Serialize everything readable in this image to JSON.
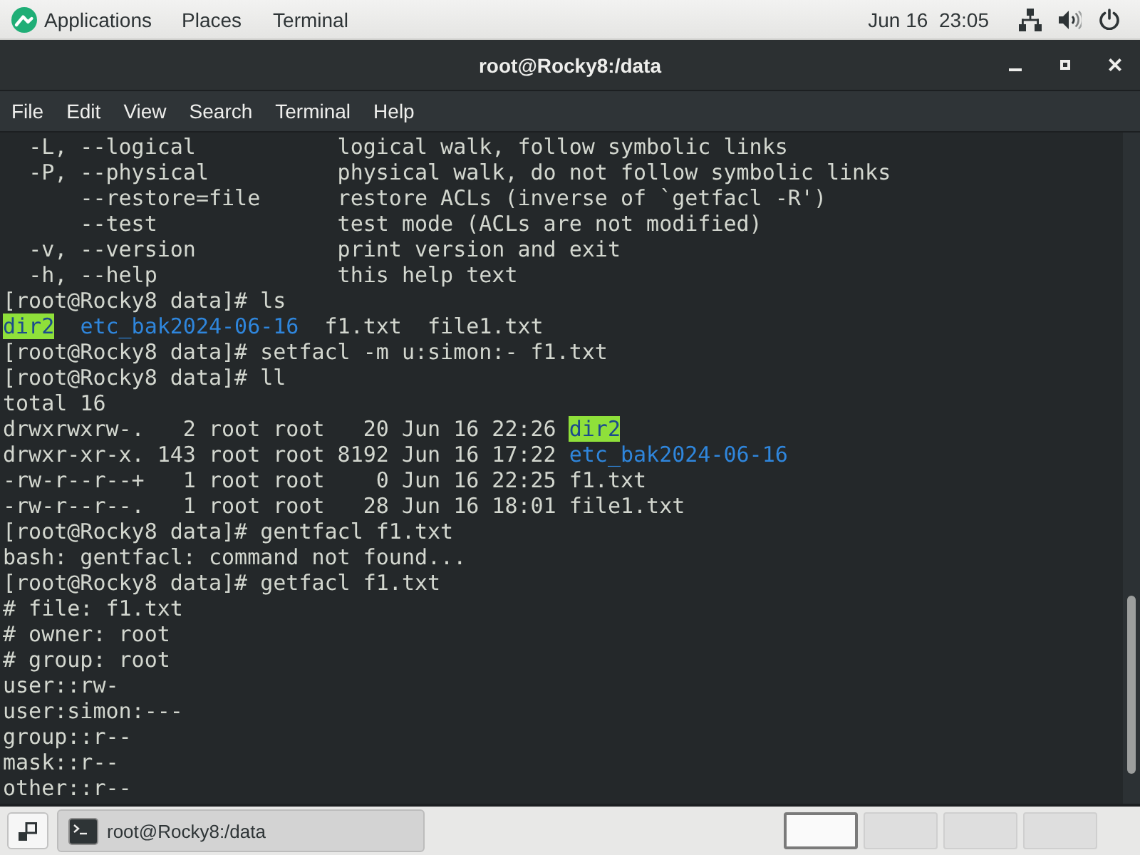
{
  "top_bar": {
    "menus": [
      "Applications",
      "Places",
      "Terminal"
    ],
    "clock": "Jun 16  23:05"
  },
  "window": {
    "title": "root@Rocky8:/data"
  },
  "menu_bar": [
    "File",
    "Edit",
    "View",
    "Search",
    "Terminal",
    "Help"
  ],
  "terminal": {
    "lines": [
      [
        {
          "kind": "text",
          "text": "  -L, --logical           logical walk, follow symbolic links"
        }
      ],
      [
        {
          "kind": "text",
          "text": "  -P, --physical          physical walk, do not follow symbolic links"
        }
      ],
      [
        {
          "kind": "text",
          "text": "      --restore=file      restore ACLs (inverse of `getfacl -R')"
        }
      ],
      [
        {
          "kind": "text",
          "text": "      --test              test mode (ACLs are not modified)"
        }
      ],
      [
        {
          "kind": "text",
          "text": "  -v, --version           print version and exit"
        }
      ],
      [
        {
          "kind": "text",
          "text": "  -h, --help              this help text"
        }
      ],
      [
        {
          "kind": "text",
          "text": "[root@Rocky8 data]# ls"
        }
      ],
      [
        {
          "kind": "dir_other_writable",
          "text": "dir2"
        },
        {
          "kind": "dir",
          "text": "  etc_bak2024-06-16"
        },
        {
          "kind": "file",
          "text": "  f1.txt"
        },
        {
          "kind": "file",
          "text": "  file1.txt"
        }
      ],
      [
        {
          "kind": "text",
          "text": "[root@Rocky8 data]# setfacl -m u:simon:- f1.txt"
        }
      ],
      [
        {
          "kind": "text",
          "text": "[root@Rocky8 data]# ll"
        }
      ],
      [
        {
          "kind": "text",
          "text": "total 16"
        }
      ],
      [
        {
          "kind": "text",
          "text": "drwxrwxrw-.   2 root root   20 Jun 16 22:26 "
        },
        {
          "kind": "dir_other_writable",
          "text": "dir2"
        }
      ],
      [
        {
          "kind": "text",
          "text": "drwxr-xr-x. 143 root root 8192 Jun 16 17:22 "
        },
        {
          "kind": "dir",
          "text": "etc_bak2024-06-16"
        }
      ],
      [
        {
          "kind": "text",
          "text": "-rw-r--r--+   1 root root    0 Jun 16 22:25 f1.txt"
        }
      ],
      [
        {
          "kind": "text",
          "text": "-rw-r--r--.   1 root root   28 Jun 16 18:01 file1.txt"
        }
      ],
      [
        {
          "kind": "text",
          "text": "[root@Rocky8 data]# gentfacl f1.txt"
        }
      ],
      [
        {
          "kind": "text",
          "text": "bash: gentfacl: command not found..."
        }
      ],
      [
        {
          "kind": "text",
          "text": "[root@Rocky8 data]# getfacl f1.txt"
        }
      ],
      [
        {
          "kind": "text",
          "text": "# file: f1.txt"
        }
      ],
      [
        {
          "kind": "text",
          "text": "# owner: root"
        }
      ],
      [
        {
          "kind": "text",
          "text": "# group: root"
        }
      ],
      [
        {
          "kind": "text",
          "text": "user::rw-"
        }
      ],
      [
        {
          "kind": "text",
          "text": "user:simon:---"
        }
      ],
      [
        {
          "kind": "text",
          "text": "group::r--"
        }
      ],
      [
        {
          "kind": "text",
          "text": "mask::r--"
        }
      ],
      [
        {
          "kind": "text",
          "text": "other::r--"
        }
      ]
    ]
  },
  "taskbar": {
    "window_button": "root@Rocky8:/data",
    "workspaces": [
      {
        "selected": true
      },
      {
        "selected": false
      },
      {
        "selected": false
      },
      {
        "selected": false
      }
    ]
  }
}
